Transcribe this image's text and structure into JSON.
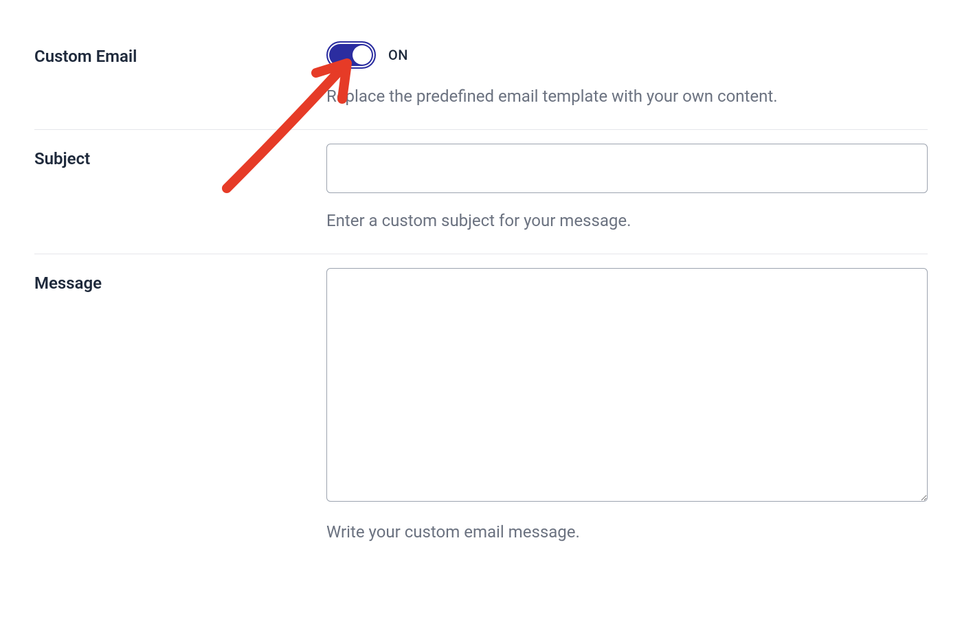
{
  "customEmail": {
    "label": "Custom Email",
    "toggleState": "ON",
    "help": "Replace the predefined email template with your own content."
  },
  "subject": {
    "label": "Subject",
    "value": "",
    "help": "Enter a custom subject for your message."
  },
  "message": {
    "label": "Message",
    "value": "",
    "help": "Write your custom email message."
  },
  "colors": {
    "accent": "#2b2da0",
    "annotation": "#e63b27"
  }
}
